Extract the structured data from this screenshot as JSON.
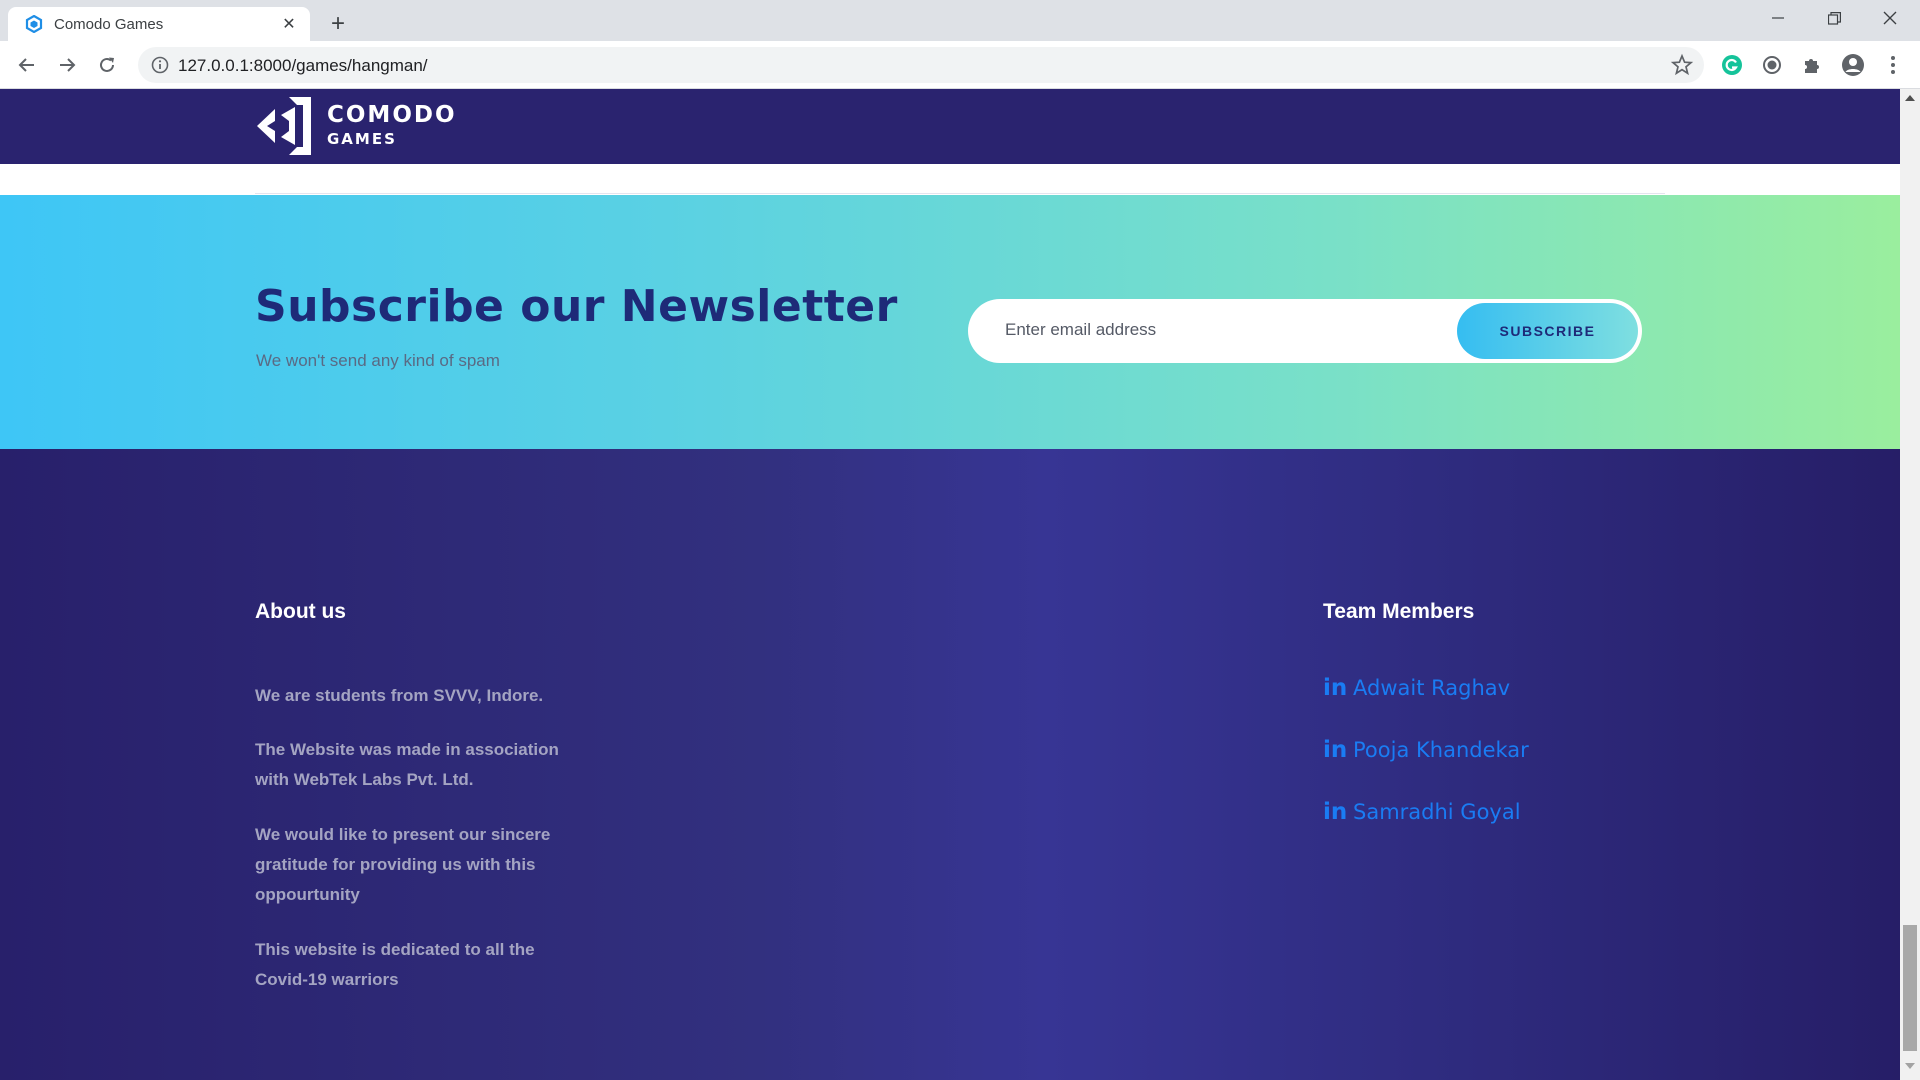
{
  "browser": {
    "tab_title": "Comodo Games",
    "url": "127.0.0.1:8000/games/hangman/"
  },
  "site": {
    "logo_line1": "COMODO",
    "logo_line2": "GAMES"
  },
  "newsletter": {
    "title": "Subscribe our Newsletter",
    "subtitle": "We won't send any kind of spam",
    "email_placeholder": "Enter email address",
    "subscribe_label": "SUBSCRIBE"
  },
  "footer": {
    "about_title": "About us",
    "about_paragraphs": [
      "We are students from SVVV, Indore.",
      "The Website was made in association with WebTek Labs Pvt. Ltd.",
      "We would like to present our sincere gratitude for providing us with this oppourtunity",
      "This website is dedicated to all the Covid-19 warriors"
    ],
    "team_title": "Team Members",
    "team_icon": "in",
    "members": [
      "Adwait Raghav",
      "Pooja Khandekar",
      "Samradhi Goyal"
    ]
  },
  "colors": {
    "header_bg": "#2a236f",
    "newsletter_gradient_start": "#3ec6f6",
    "newsletter_gradient_end": "#9aee9e",
    "title_color": "#1e2a78",
    "link_color": "#1a7cf3"
  }
}
